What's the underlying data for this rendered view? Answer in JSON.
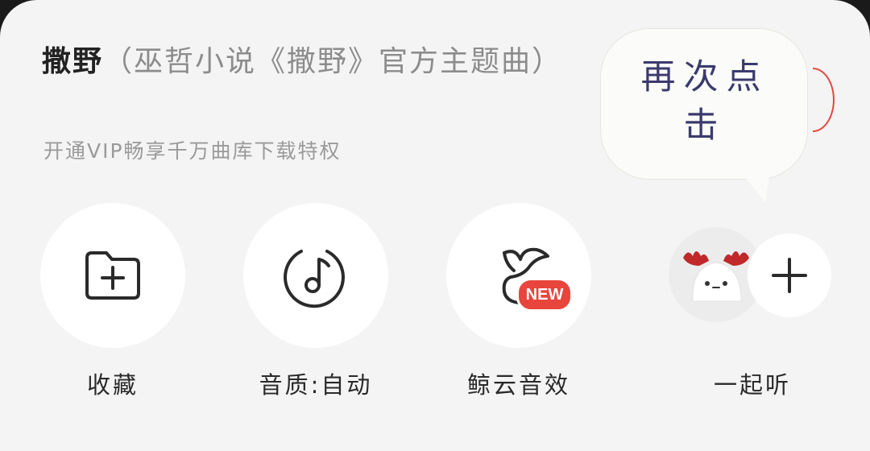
{
  "song": {
    "name": "撒野",
    "subtitle": "（巫哲小说《撒野》官方主题曲）"
  },
  "vip_promo": "开通VIP畅享千万曲库下载特权",
  "bubble": {
    "line1": "再次点",
    "line2": "击"
  },
  "actions": [
    {
      "label": "收藏",
      "icon": "folder-plus-icon"
    },
    {
      "label": "音质:自动",
      "icon": "sound-quality-icon"
    },
    {
      "label": "鲸云音效",
      "icon": "whale-tail-icon",
      "badge": "NEW"
    },
    {
      "label": "一起听",
      "icon": "listen-together-icon"
    }
  ],
  "colors": {
    "background": "#f4f4f4",
    "accent_red": "#e8453d",
    "bubble_text": "#3b3a6e"
  }
}
